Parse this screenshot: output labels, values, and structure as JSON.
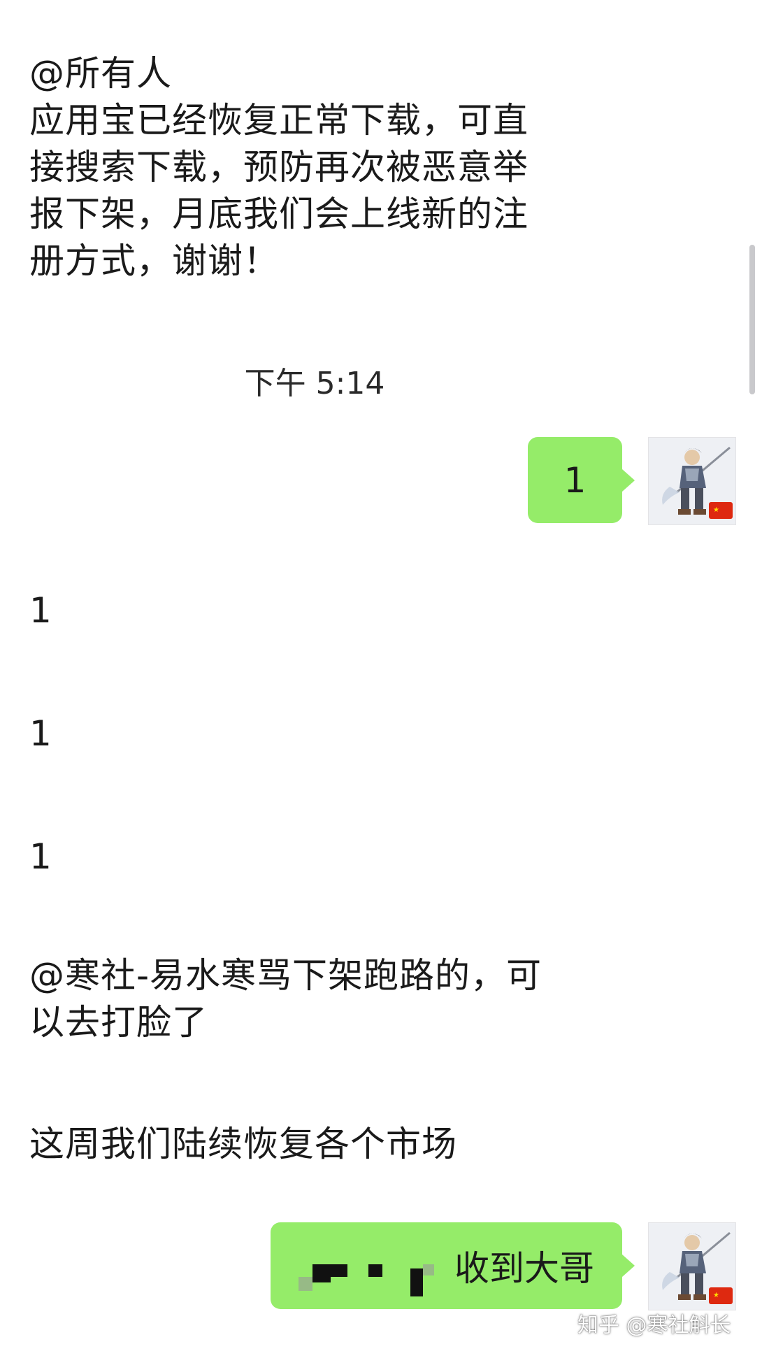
{
  "messages": {
    "announcement": "@所有人\n应用宝已经恢复正常下载，可直\n接搜索下载，预防再次被恶意举\n报下架，月底我们会上线新的注\n册方式，谢谢！",
    "timestamp": "下午 5:14",
    "my_reply_1": "1",
    "reply_a": "1",
    "reply_b": "1",
    "reply_c": "1",
    "mention_msg": "@寒社-易水寒骂下架跑路的，可\n以去打脸了",
    "market_msg": "这周我们陆续恢复各个市场",
    "my_reply_2": "收到大哥"
  },
  "watermark": "知乎 @寒社斛长",
  "colors": {
    "bubble": "#95ec69",
    "background": "#ffffff",
    "text": "#1a1a1a"
  },
  "icons": {
    "avatar": "warrior-avatar-icon",
    "flag": "china-flag-icon"
  }
}
